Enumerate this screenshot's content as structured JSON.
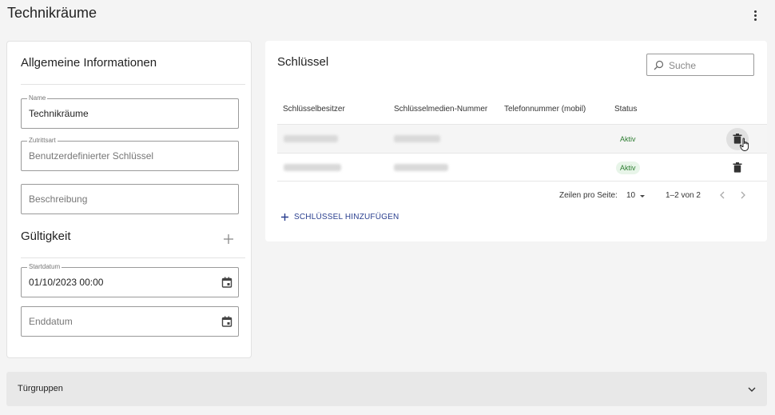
{
  "page": {
    "title": "Technikräume"
  },
  "general": {
    "title": "Allgemeine Informationen",
    "name_label": "Name",
    "name_value": "Technikräume",
    "access_label": "Zutrittsart",
    "access_value": "Benutzerdefinierter Schlüssel",
    "description_placeholder": "Beschreibung"
  },
  "validity": {
    "title": "Gültigkeit",
    "start_label": "Startdatum",
    "start_value": "01/10/2023 00:00",
    "end_placeholder": "Enddatum"
  },
  "keys": {
    "title": "Schlüssel",
    "search_placeholder": "Suche",
    "columns": [
      "Schlüsselbesitzer",
      "Schlüsselmedien-Nummer",
      "Telefonnummer (mobil)",
      "Status"
    ],
    "rows": [
      {
        "status": "Aktiv"
      },
      {
        "status": "Aktiv"
      }
    ],
    "rows_per_page_label": "Zeilen pro Seite:",
    "rows_per_page_value": "10",
    "range": "1–2 von 2",
    "add_label": "SCHLÜSSEL HINZUFÜGEN"
  },
  "door_groups": {
    "title": "Türgruppen"
  },
  "colors": {
    "accent": "#2a3f8f",
    "status_green": "#2e7d32"
  },
  "icons": [
    "kebab-menu-icon",
    "calendar-icon",
    "plus-icon",
    "search-icon",
    "trash-icon",
    "chevron-left-icon",
    "chevron-right-icon",
    "chevron-down-icon",
    "pointer-cursor-icon"
  ]
}
